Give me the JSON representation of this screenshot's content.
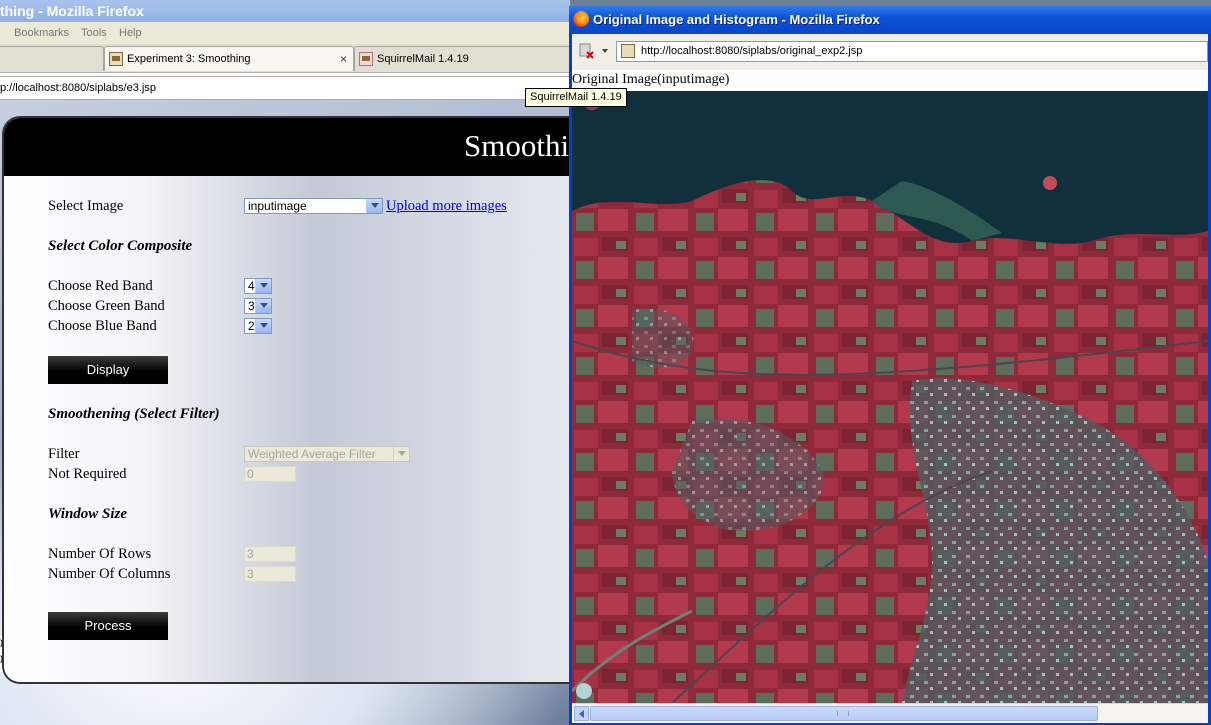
{
  "back_window": {
    "title": "thing - Mozilla Firefox",
    "menu": [
      "Bookmarks",
      "Tools",
      "Help"
    ],
    "tabs": [
      {
        "label": "Experiment 3: Smoothing",
        "close": "×"
      },
      {
        "label": "SquirrelMail 1.4.19"
      }
    ],
    "url": "p://localhost:8080/siplabs/e3.jsp",
    "tooltip": "SquirrelMail 1.4.19",
    "page": {
      "heading": "Smoothi",
      "select_image_label": "Select Image",
      "select_image_value": "inputimage",
      "upload_link": "Upload more images",
      "color_composite_heading": "Select Color Composite",
      "red_band_label": "Choose Red Band",
      "red_band_value": "4",
      "green_band_label": "Choose Green Band",
      "green_band_value": "3",
      "blue_band_label": "Choose Blue Band",
      "blue_band_value": "2",
      "display_button": "Display",
      "smoothening_heading": "Smoothening (Select Filter)",
      "filter_label": "Filter",
      "filter_value": "Weighted Average Filter",
      "not_required_label": "Not Required",
      "not_required_value": "0",
      "window_size_heading": "Window Size",
      "rows_label": "Number Of Rows",
      "rows_value": "3",
      "cols_label": "Number Of Columns",
      "cols_value": "3",
      "process_button": "Process",
      "edge_digits": [
        "0",
        "0"
      ]
    }
  },
  "front_window": {
    "title": "Original Image and Histogram - Mozilla Firefox",
    "url": "http://localhost:8080/siplabs/original_exp2.jsp",
    "caption": "Original Image(inputimage)",
    "image_description_colors": {
      "fields": "#8f2a3b",
      "sea": "#0f2e3a",
      "urban": "#4e7f7c"
    }
  },
  "colors": {
    "xp_title_blue": "#0a46c8",
    "link_blue": "#0000ee",
    "panel_head": "#000000"
  }
}
